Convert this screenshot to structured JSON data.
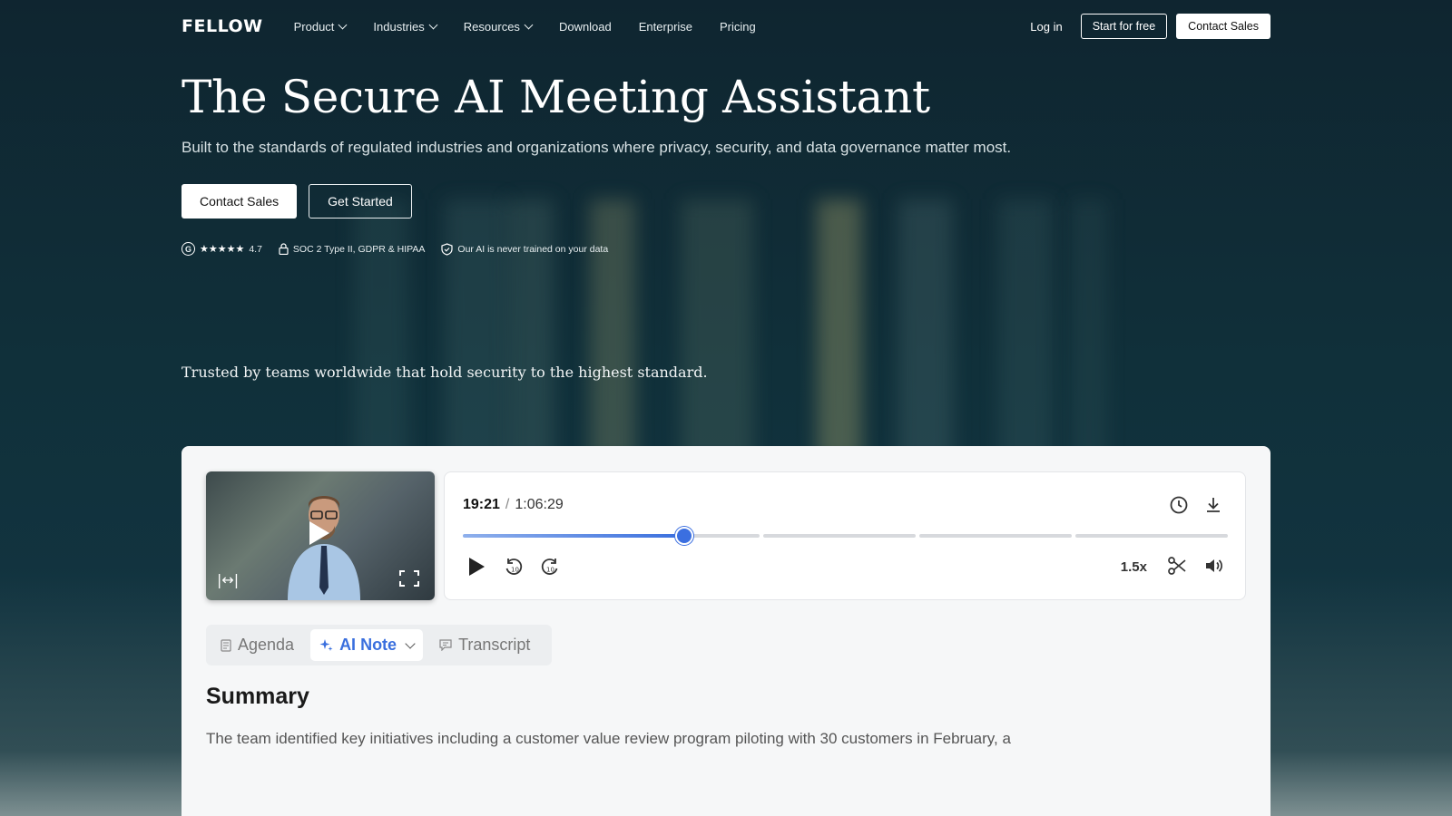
{
  "nav": {
    "logo": "FELLOW",
    "items": [
      {
        "label": "Product",
        "has_dropdown": true
      },
      {
        "label": "Industries",
        "has_dropdown": true
      },
      {
        "label": "Resources",
        "has_dropdown": true
      },
      {
        "label": "Download",
        "has_dropdown": false
      },
      {
        "label": "Enterprise",
        "has_dropdown": false
      },
      {
        "label": "Pricing",
        "has_dropdown": false
      }
    ],
    "login": "Log in",
    "start_free": "Start for free",
    "contact_sales": "Contact Sales"
  },
  "hero": {
    "title": "The Secure AI Meeting Assistant",
    "subtitle": "Built to the standards of regulated industries and organizations where privacy, security, and data governance matter most.",
    "cta_primary": "Contact Sales",
    "cta_secondary": "Get Started"
  },
  "badges": {
    "g2_logo": "G",
    "stars": "★★★★★",
    "rating": "4.7",
    "compliance": "SOC 2 Type II, GDPR & HIPAA",
    "ai_promise": "Our AI is never trained on your data"
  },
  "trusted": "Trusted by teams worldwide that hold security to the highest standard.",
  "player": {
    "current_time": "19:21",
    "separator": "/",
    "duration": "1:06:29",
    "progress_fraction": 0.29,
    "speed": "1.5x"
  },
  "tabs": [
    {
      "label": "Agenda",
      "icon": "document-icon",
      "active": false
    },
    {
      "label": "AI Note",
      "icon": "sparkle-icon",
      "active": true
    },
    {
      "label": "Transcript",
      "icon": "chat-icon",
      "active": false
    }
  ],
  "summary": {
    "heading": "Summary",
    "text": "The team identified key initiatives including a customer value review program piloting with 30 customers in February, a"
  },
  "colors": {
    "background": "#0f2530",
    "accent": "#3b6fe0"
  }
}
